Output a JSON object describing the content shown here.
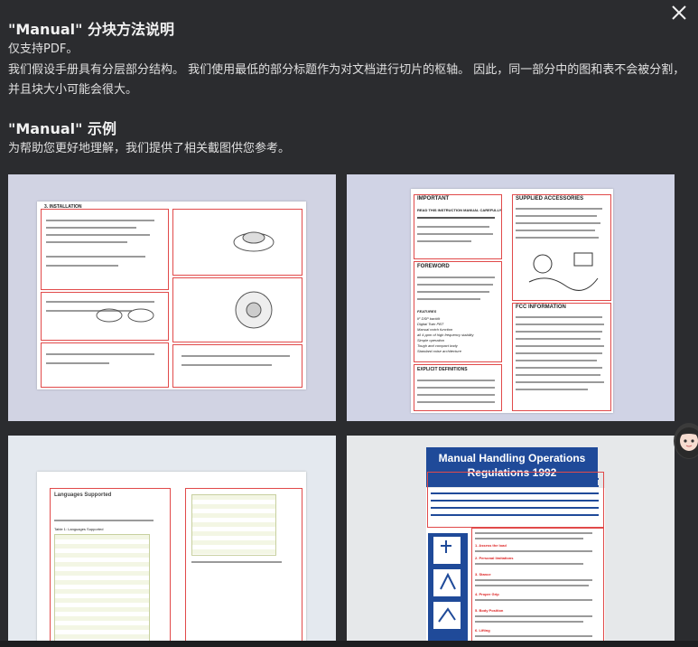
{
  "modal": {
    "section1_title": "\"Manual\" 分块方法说明",
    "support_text": "仅支持PDF。",
    "description": "我们假设手册具有分层部分结构。 我们使用最低的部分标题作为对文档进行切片的枢轴。 因此，同一部分中的图和表不会被分割，并且块大小可能会很大。",
    "section2_title": "\"Manual\" 示例",
    "example_intro": "为帮助您更好地理解，我们提供了相关截图供您参考。"
  },
  "examples": [
    {
      "name": "installation-manual",
      "heading": "3. INSTALLATION"
    },
    {
      "name": "radio-manual",
      "sections": [
        "IMPORTANT",
        "SUPPLIED ACCESSORIES",
        "FOREWORD",
        "EXPLICIT DEFINITIONS",
        "FCC INFORMATION"
      ],
      "important_text": "READ THIS INSTRUCTION MANUAL CAREFULLY",
      "features_title": "FEATURES",
      "features": [
        "IF DSP backlit",
        "Digital Twin PBT",
        "Manual notch function",
        "all 4 ppm of high frequency stability",
        "Simple operation",
        "Tough and compact body",
        "Standard noise architecture"
      ]
    },
    {
      "name": "languages-manual",
      "heading": "Languages Supported",
      "table_caption": "Table 1: Languages Supported"
    },
    {
      "name": "manual-handling",
      "title_line1": "Manual Handling Operations",
      "title_line2": "Regulations 1992",
      "steps": [
        "1. Assess the load",
        "2. Personal limitations",
        "3. Stance",
        "4. Proper Grip",
        "5. Body Position",
        "6. Lifting"
      ]
    }
  ],
  "icons": {
    "close": "close-icon",
    "avatar": "assistant-avatar-icon"
  },
  "colors": {
    "background": "#2b2c2f",
    "highlight": "#e14a4a",
    "mh_banner": "#1f4a99"
  }
}
